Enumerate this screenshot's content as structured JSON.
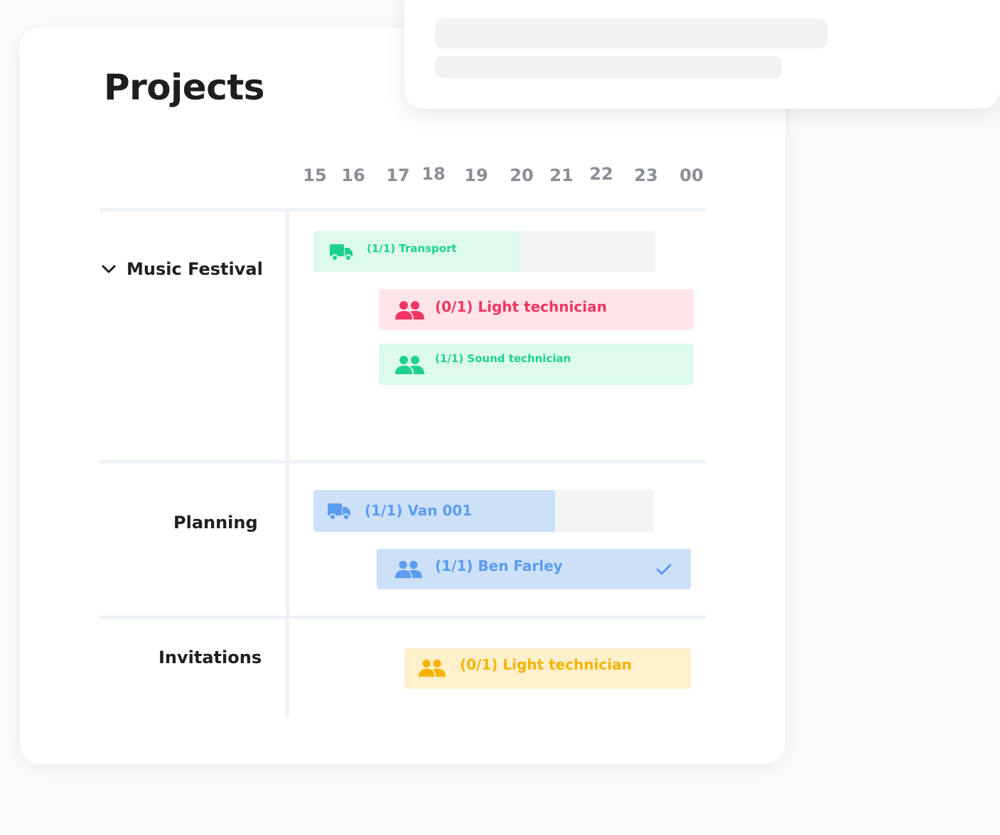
{
  "page": {
    "title": "Projects"
  },
  "timeline": {
    "hours": [
      "15",
      "16",
      "17",
      "18",
      "19",
      "20",
      "21",
      "22",
      "23",
      "00"
    ]
  },
  "groups": [
    {
      "name": "Music Festival",
      "expanded": true,
      "toggle_icon": "chevron-down-icon"
    },
    {
      "name": "Planning"
    },
    {
      "name": "Invitations"
    }
  ],
  "bookings": {
    "transport": {
      "label": "(1/1) Transport",
      "icon": "truck-icon",
      "color": "#1dd28c",
      "bg": "#dcfbec",
      "progress": 0.6
    },
    "light_tech_1": {
      "label": "(0/1) Light technician",
      "icon": "people-icon",
      "color": "#f23562",
      "bg": "#ffe5ea"
    },
    "sound_tech": {
      "label": "(1/1) Sound technician",
      "icon": "people-icon",
      "color": "#1dd28c",
      "bg": "#dcfbec"
    },
    "van": {
      "label": "(1/1) Van 001",
      "icon": "truck-icon",
      "color": "#5b9cf0",
      "bg": "#cce0f8",
      "progress": 0.71
    },
    "ben": {
      "label": "(1/1) Ben Farley",
      "icon": "people-icon",
      "color": "#5b9cf0",
      "bg": "#cce0f8",
      "confirmed_icon": "checkmark-icon"
    },
    "light_tech_2": {
      "label": "(0/1) Light technician",
      "icon": "people-icon",
      "color": "#f5b400",
      "bg": "#fff0cc"
    }
  },
  "colors": {
    "remainder": "#f3f4f6",
    "title": "#1e1e1e",
    "hour_text": "#8a8f96"
  }
}
